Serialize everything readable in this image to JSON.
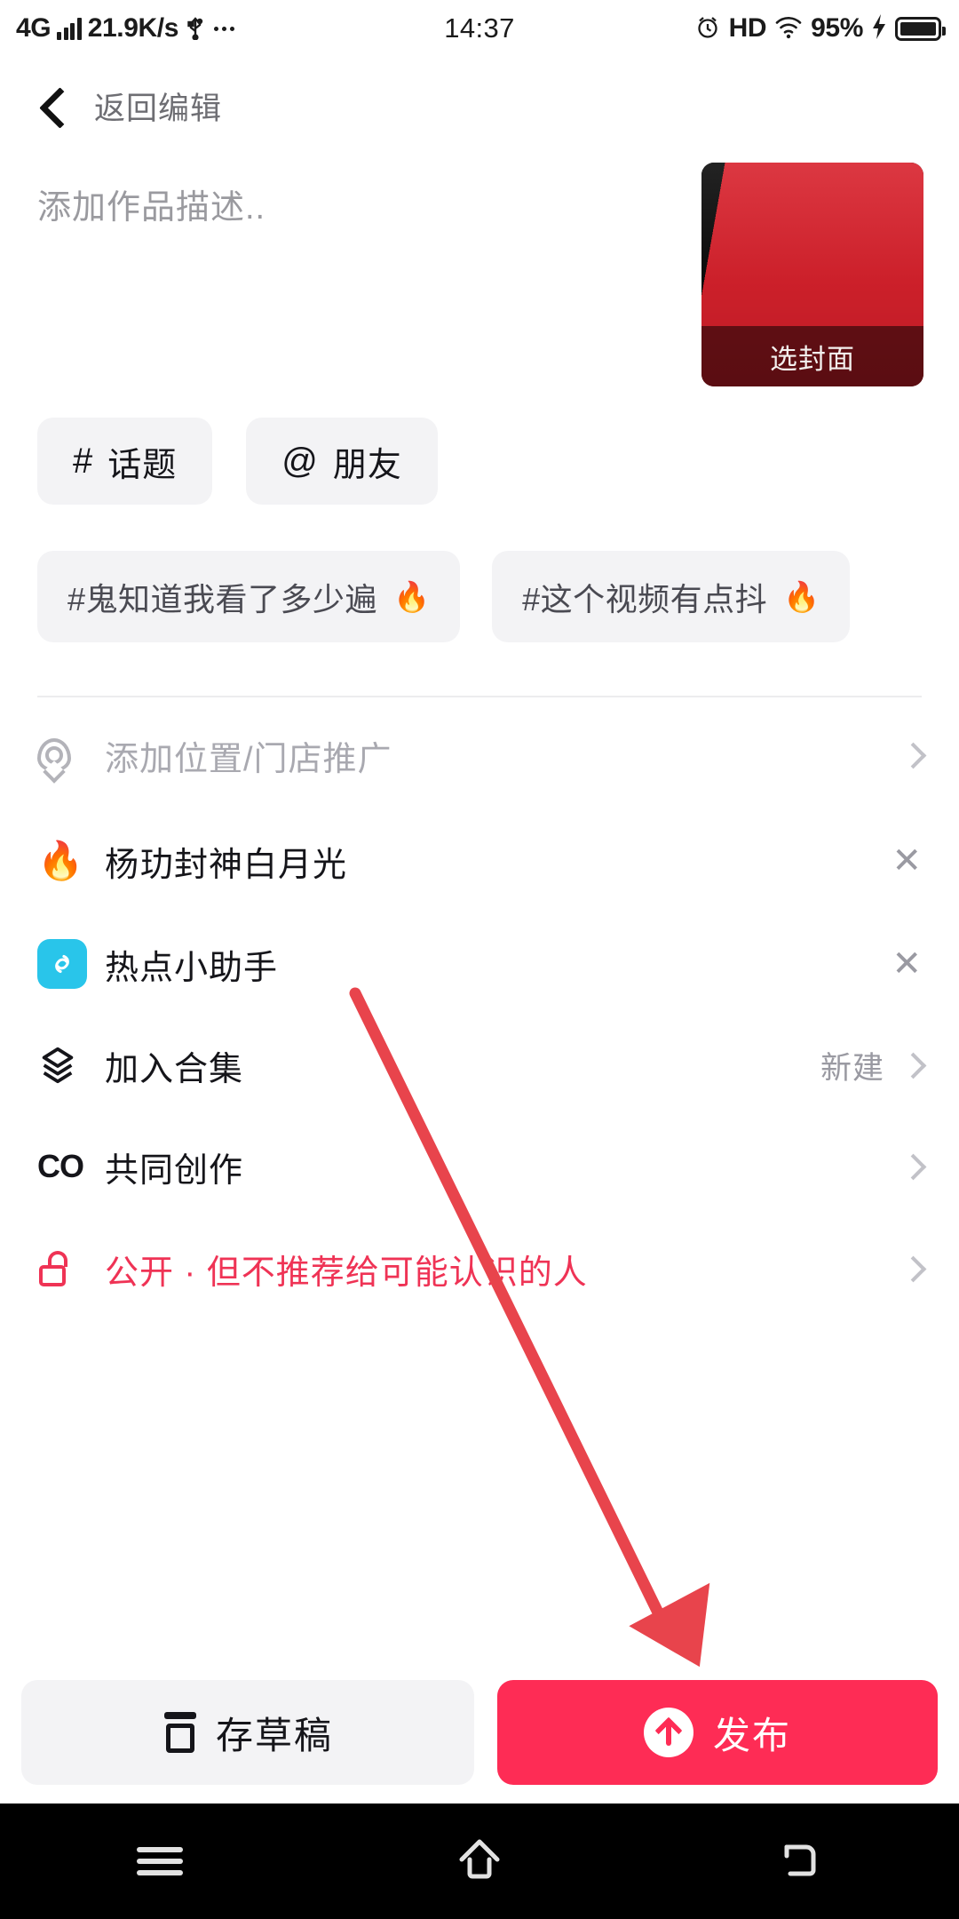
{
  "status_bar": {
    "network_type": "4G",
    "speed": "21.9K/s",
    "usb_icon": "usb-icon",
    "more_icon": "more-dots-icon",
    "time": "14:37",
    "alarm_icon": "alarm-icon",
    "hd": "HD",
    "wifi_icon": "wifi-icon",
    "battery_percent": "95%",
    "charging_icon": "charging-bolt-icon"
  },
  "header": {
    "back_icon": "chevron-left-icon",
    "back_label": "返回编辑"
  },
  "composer": {
    "description_placeholder": "添加作品描述..",
    "description_value": "",
    "cover": {
      "select_cover_label": "选封面",
      "image_colors": [
        "#0a0a0a",
        "#d8212c"
      ]
    }
  },
  "action_chips": [
    {
      "symbol": "#",
      "label": "话题",
      "icon": "hash-icon"
    },
    {
      "symbol": "@",
      "label": "朋友",
      "icon": "at-icon"
    }
  ],
  "suggested_tags": [
    {
      "label": "#鬼知道我看了多少遍",
      "flame": "🔥"
    },
    {
      "label": "#这个视频有点抖",
      "flame": "🔥"
    }
  ],
  "option_rows": [
    {
      "icon": "location-pin-icon",
      "label": "添加位置/门店推广",
      "muted": true,
      "value": "",
      "trailing": "chevron-right-icon"
    },
    {
      "icon": "fire-icon",
      "label": "杨玏封神白月光",
      "muted": false,
      "value": "",
      "trailing": "close-icon"
    },
    {
      "icon": "hotspot-assistant-icon",
      "label": "热点小助手",
      "muted": false,
      "value": "",
      "trailing": "close-icon"
    },
    {
      "icon": "layers-icon",
      "label": "加入合集",
      "muted": false,
      "value": "新建",
      "trailing": "chevron-right-icon"
    },
    {
      "icon": "co-create-icon",
      "label": "共同创作",
      "muted": false,
      "value": "",
      "trailing": "chevron-right-icon"
    },
    {
      "icon": "unlock-icon",
      "label": "公开 · 但不推荐给可能认识的人",
      "muted": false,
      "pink": true,
      "value": "",
      "trailing": "chevron-right-icon"
    }
  ],
  "bottom_bar": {
    "draft_label": "存草稿",
    "draft_icon": "save-draft-icon",
    "publish_label": "发布",
    "publish_icon": "upload-arrow-icon",
    "publish_color": "#fe2c55"
  },
  "android_nav": {
    "recents_icon": "menu-icon",
    "home_icon": "home-icon",
    "back_icon": "back-arrow-icon"
  },
  "annotation": {
    "arrow_color": "#e8444c",
    "points_to": "publish-button"
  }
}
